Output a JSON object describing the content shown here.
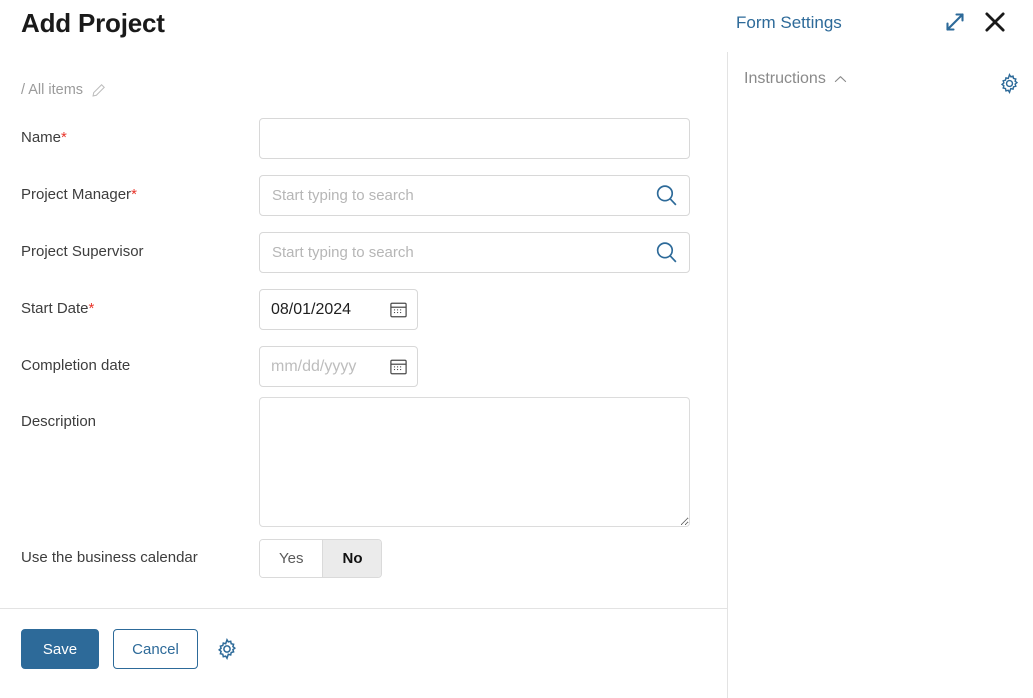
{
  "page": {
    "title": "Add Project",
    "breadcrumb": "/ All items",
    "breadcrumb_edit_icon": "pencil-icon"
  },
  "form": {
    "fields": [
      {
        "label": "Name",
        "required": true,
        "required_marker": "*",
        "type": "text",
        "value": "",
        "placeholder": ""
      },
      {
        "label": "Project Manager",
        "required": true,
        "required_marker": "*",
        "type": "search",
        "value": "",
        "placeholder": "Start typing to search",
        "icon": "search-icon"
      },
      {
        "label": "Project Supervisor",
        "required": false,
        "required_marker": "",
        "type": "search",
        "value": "",
        "placeholder": "Start typing to search",
        "icon": "search-icon"
      },
      {
        "label": "Start Date",
        "required": true,
        "required_marker": "*",
        "type": "date",
        "value": "08/01/2024",
        "placeholder": "mm/dd/yyyy",
        "icon": "calendar-icon"
      },
      {
        "label": "Completion date",
        "required": false,
        "required_marker": "",
        "type": "date",
        "value": "",
        "placeholder": "mm/dd/yyyy",
        "icon": "calendar-icon"
      },
      {
        "label": "Description",
        "required": false,
        "required_marker": "",
        "type": "textarea",
        "value": "",
        "placeholder": ""
      },
      {
        "label": "Use the business calendar",
        "required": false,
        "required_marker": "",
        "type": "toggle",
        "options": [
          "Yes",
          "No"
        ],
        "selected": "No"
      }
    ]
  },
  "footer": {
    "save_label": "Save",
    "cancel_label": "Cancel",
    "settings_icon": "gear-icon"
  },
  "settings_panel": {
    "title": "Form Settings",
    "expand_icon": "expand-arrows-icon",
    "close_icon": "close-icon",
    "section_label": "Instructions",
    "section_chevron": "chevron-up-icon",
    "section_gear_icon": "gear-icon"
  },
  "colors": {
    "accent_blue": "#2d6a99",
    "required_red": "#e8352b",
    "label_gray": "#3d3d3d",
    "placeholder_gray": "#b6b6b6",
    "border_gray": "#d8d8d8",
    "toggle_selected_bg": "#ebebeb"
  }
}
